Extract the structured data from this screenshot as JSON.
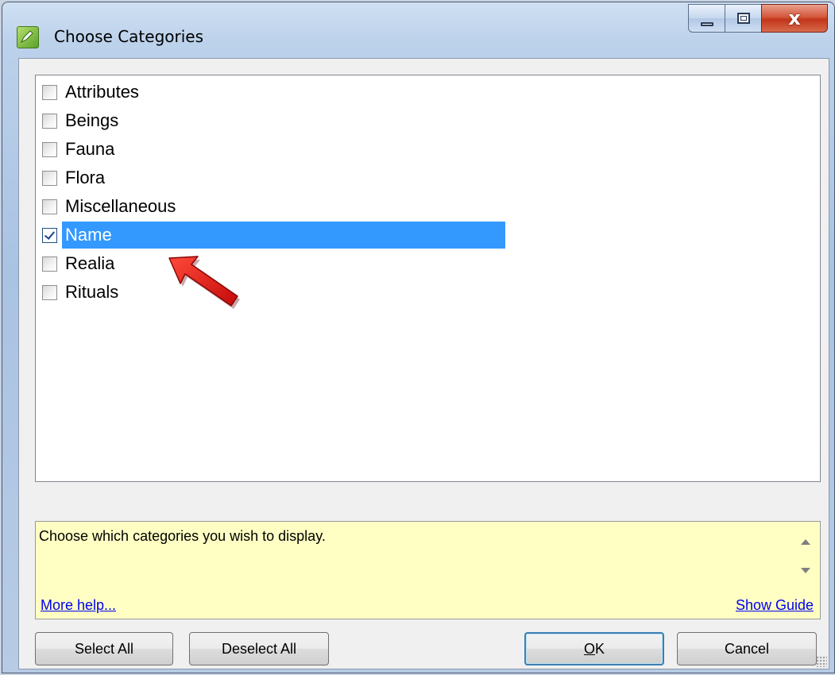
{
  "window": {
    "title": "Choose Categories",
    "icon": "pencil-app-icon",
    "controls": {
      "minimize": "minimize-icon",
      "maximize": "maximize-icon",
      "close_glyph": "x"
    }
  },
  "categories": {
    "items": [
      {
        "label": "Attributes",
        "checked": false
      },
      {
        "label": "Beings",
        "checked": false
      },
      {
        "label": "Fauna",
        "checked": false
      },
      {
        "label": "Flora",
        "checked": false
      },
      {
        "label": "Miscellaneous",
        "checked": false
      },
      {
        "label": "Name",
        "checked": true,
        "selected": true
      },
      {
        "label": "Realia",
        "checked": false
      },
      {
        "label": "Rituals",
        "checked": false
      }
    ],
    "selection_color": "#3399ff"
  },
  "help": {
    "text": "Choose which categories you wish to display.",
    "more_link": "More help...",
    "guide_link": "Show Guide",
    "background": "#ffffc4"
  },
  "buttons": {
    "select_all": "Select All",
    "deselect_all": "Deselect All",
    "ok_mnemonic": "O",
    "ok_rest": "K",
    "cancel": "Cancel"
  },
  "annotation": {
    "pointer_color": "#e01010",
    "pointer_icon": "red-arrow-icon"
  }
}
